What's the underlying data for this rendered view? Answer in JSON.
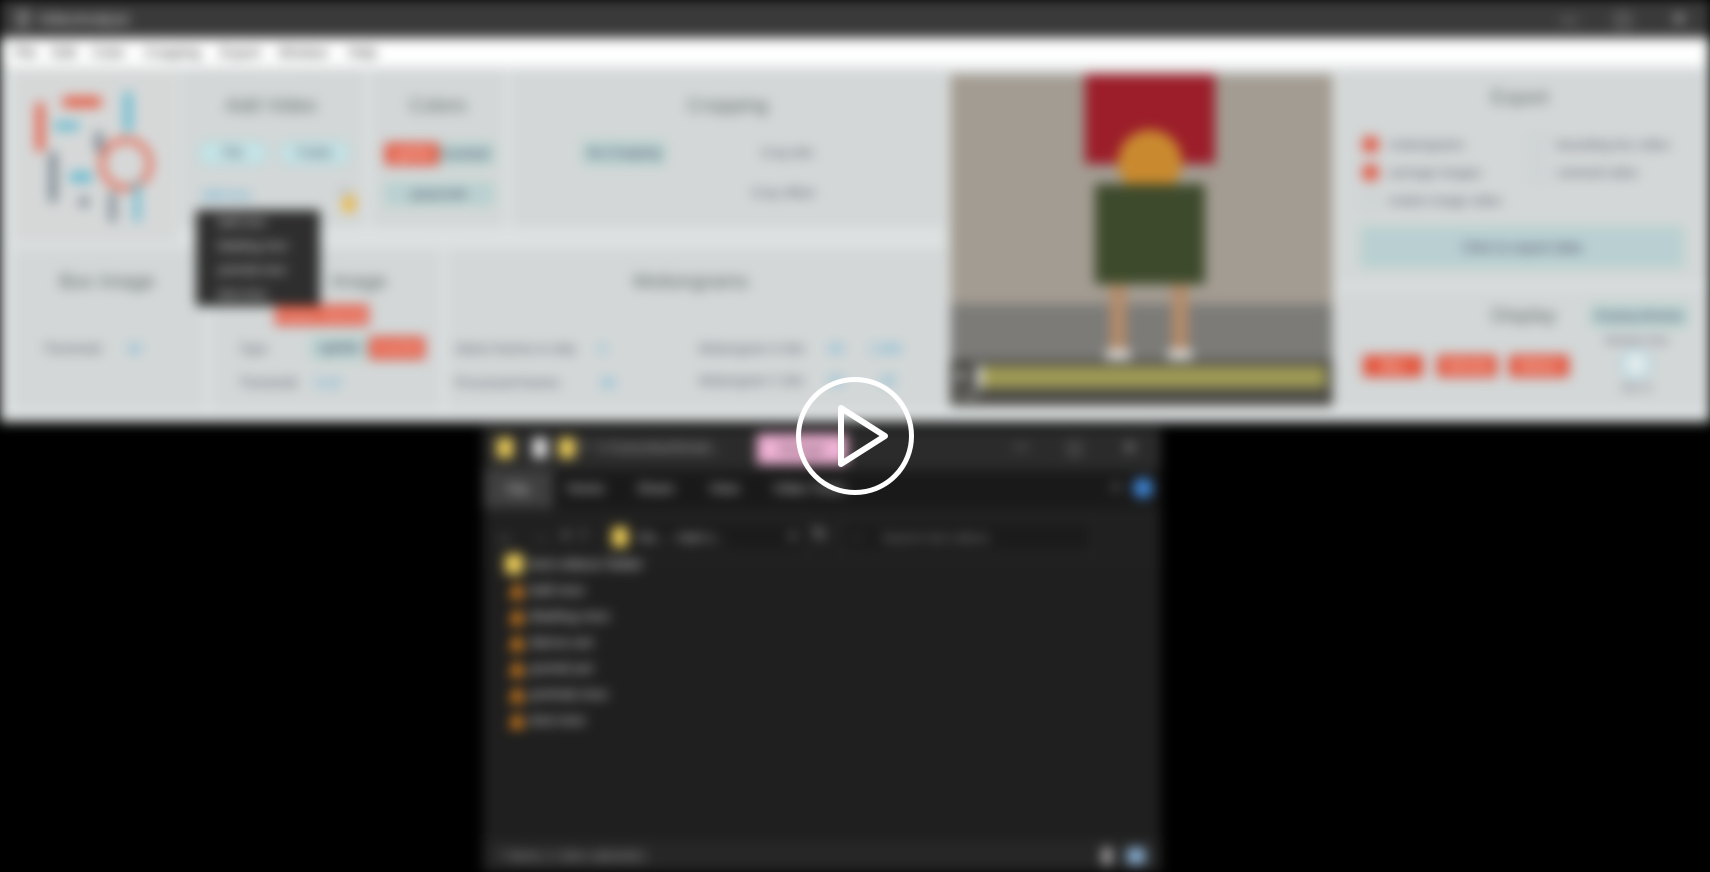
{
  "app": {
    "title": "VideoAnalyze",
    "menu": [
      "File",
      "Edit",
      "Color",
      "Cropping",
      "Export",
      "Window",
      "Help"
    ]
  },
  "add_video": {
    "heading": "Add Video",
    "file_btn": "File",
    "folder_btn": "Folder",
    "selected": "ball.mov",
    "dropdown": [
      "ball.mov",
      "blading.mov",
      "portrait.mov",
      "test.mov"
    ]
  },
  "colors": {
    "heading": "Colors",
    "btn_rgb": "rgb/blk",
    "btn_inverted": "inverted",
    "btn_grayscale": "grayscale"
  },
  "cropping": {
    "heading": "Cropping",
    "no_cropping_btn": "No Cropping",
    "crop_dim_label": "Crop dim",
    "crop_offset_label": "Crop offset"
  },
  "box_image": {
    "heading": "Box Image",
    "threshold_label": "Threshold",
    "threshold_value": "40"
  },
  "motion_image": {
    "heading_suffix": "Image",
    "frames_btn": "Frames Selected",
    "type_label": "Type",
    "type_a": "rgb/blk",
    "type_b": "inverted",
    "threshold_label": "Threshold",
    "threshold_value": "0.10"
  },
  "motiongrams": {
    "heading": "Motiongrams",
    "skip_label": "Select frames to skip",
    "skip_value": "0",
    "processed_label": "Processed frames",
    "processed_value": "60",
    "h_dim_label": "Motiongram H dim",
    "h_dim_value": "60",
    "h_dim_value2": "1.000",
    "v_dim_label": "Motiongram V dim",
    "v_dim_value": "60",
    "v_dim_value2": "60"
  },
  "video": {
    "time": "0:00",
    "progress": 0.02
  },
  "export": {
    "heading": "Export",
    "options": [
      {
        "label": "motiongrams",
        "checked": true
      },
      {
        "label": "average images",
        "checked": true
      },
      {
        "label": "motion image video",
        "checked": false
      },
      {
        "label": "bounding box video",
        "checked": false
      },
      {
        "label": "centroid video",
        "checked": false
      }
    ],
    "export_btn": "Click to export data"
  },
  "display": {
    "heading": "Display",
    "floating_btn": "Floating Window",
    "window_size_label": "Window Size",
    "btn1": "Box",
    "btn2": "Velocity",
    "btn3": "Motion",
    "knob_label": "Size %"
  },
  "explorer": {
    "path": "C:\\Users\\bart\\Deskt...",
    "manage_tab": "Manage",
    "tabs": [
      "File",
      "Home",
      "Share",
      "View",
      "Video Tools"
    ],
    "breadcrumb": "Do... › test v...",
    "search_placeholder": "Search test videos",
    "items": [
      "test-videos folder",
      "ball.mov",
      "blading.mov",
      "dance.avi",
      "pomid.avi",
      "portrait.mov",
      "test.mov"
    ],
    "status": "7 items  |  1 item selected  |"
  },
  "colors_theme": {
    "accent_red": "#e5573d",
    "accent_blue": "#36a3d4",
    "explorer_bg": "#1f1f1f"
  }
}
